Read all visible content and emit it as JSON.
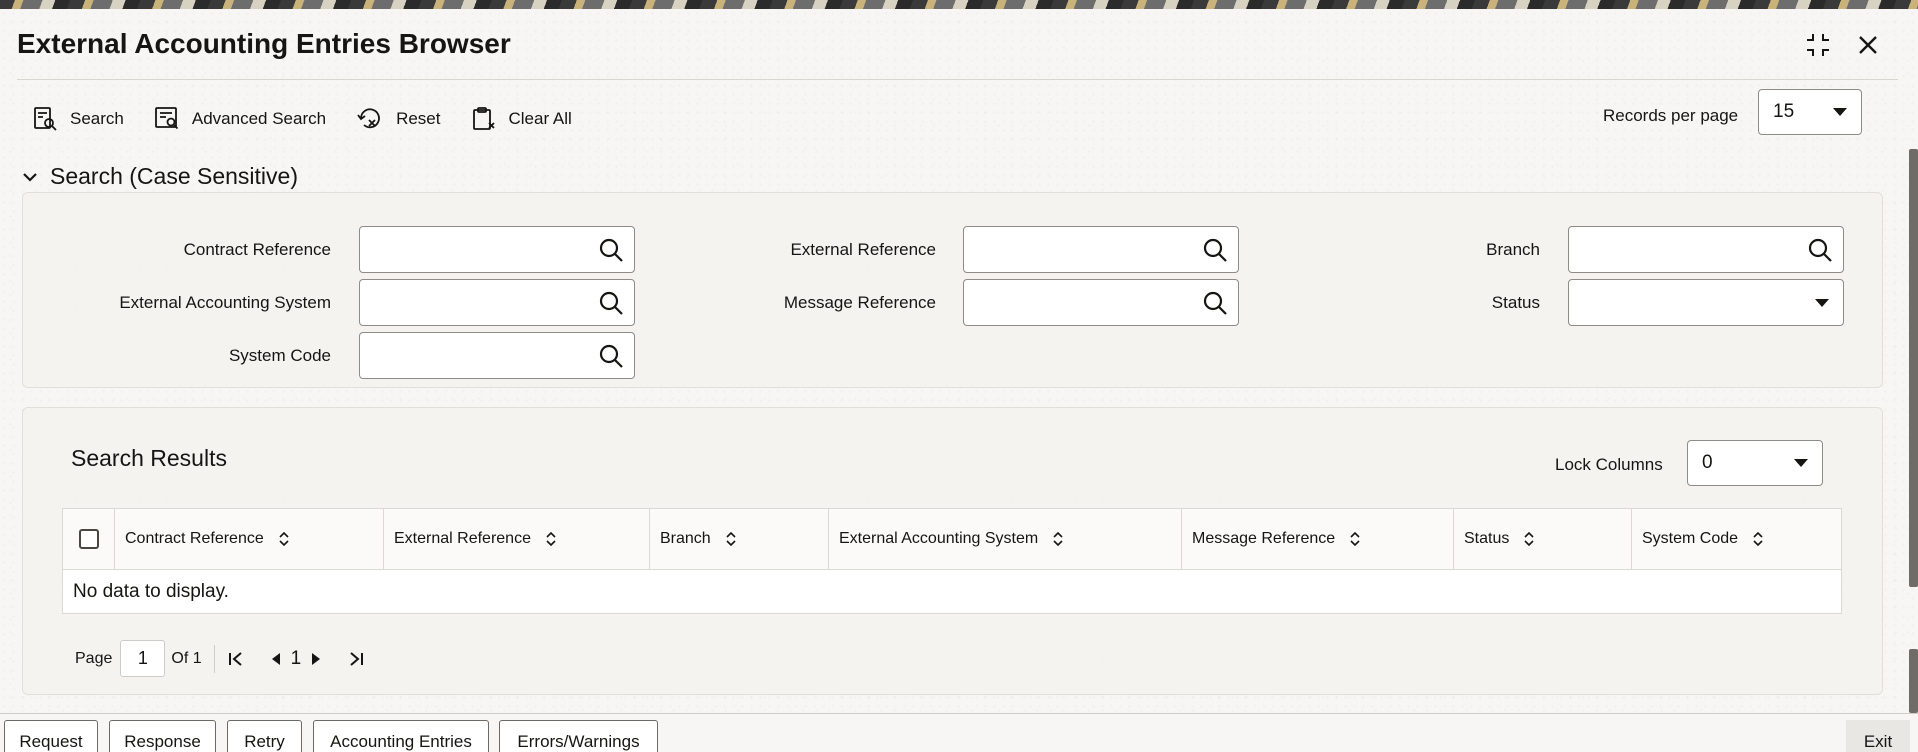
{
  "window": {
    "title": "External Accounting Entries Browser"
  },
  "toolbar": {
    "search_label": "Search",
    "advanced_search_label": "Advanced Search",
    "reset_label": "Reset",
    "clear_all_label": "Clear All",
    "records_per_page_label": "Records per page",
    "records_per_page_value": "15"
  },
  "search_section": {
    "title": "Search (Case Sensitive)",
    "fields": {
      "contract_reference": {
        "label": "Contract Reference",
        "value": ""
      },
      "external_reference": {
        "label": "External Reference",
        "value": ""
      },
      "branch": {
        "label": "Branch",
        "value": ""
      },
      "external_accounting_system": {
        "label": "External Accounting System",
        "value": ""
      },
      "message_reference": {
        "label": "Message Reference",
        "value": ""
      },
      "status": {
        "label": "Status",
        "value": ""
      },
      "system_code": {
        "label": "System Code",
        "value": ""
      }
    }
  },
  "results": {
    "title": "Search Results",
    "lock_columns_label": "Lock Columns",
    "lock_columns_value": "0",
    "columns": [
      "Contract Reference",
      "External Reference",
      "Branch",
      "External Accounting System",
      "Message Reference",
      "Status",
      "System Code"
    ],
    "empty_message": "No data to display."
  },
  "pagination": {
    "page_label": "Page",
    "current_page": "1",
    "of_label": "Of 1",
    "page_link": "1"
  },
  "footer": {
    "buttons": [
      "Request",
      "Response",
      "Retry",
      "Accounting Entries",
      "Errors/Warnings"
    ],
    "exit_label": "Exit"
  },
  "icons": {
    "search": "magnifier-icon",
    "minimize": "collapse-arrows-icon",
    "close": "close-icon"
  }
}
